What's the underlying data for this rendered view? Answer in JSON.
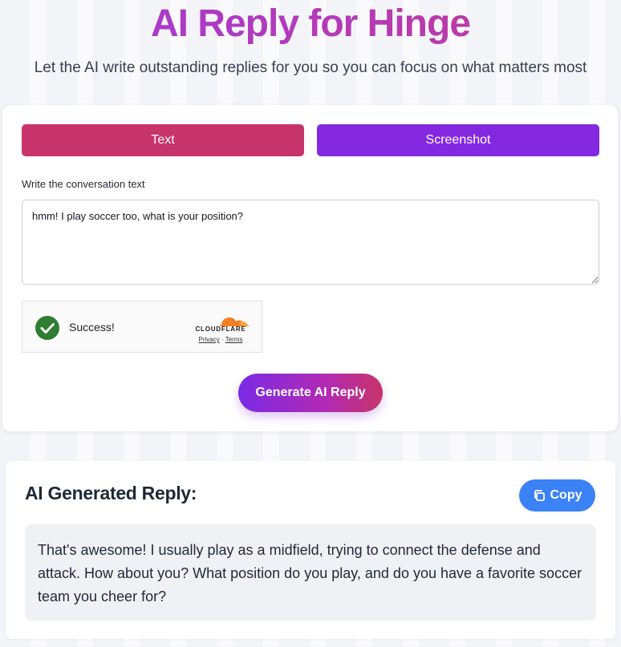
{
  "header": {
    "title": "AI Reply for Hinge",
    "subtitle": "Let the AI write outstanding replies for you so you can focus on what matters most"
  },
  "tabs": [
    {
      "label": "Text",
      "color": "#c7346a"
    },
    {
      "label": "Screenshot",
      "color": "#8428e0"
    }
  ],
  "form": {
    "label": "Write the conversation text",
    "conversation_text": "hmm! I play soccer too, what is your position?"
  },
  "captcha": {
    "status": "Success!",
    "brand": "CLOUDFLARE",
    "privacy": "Privacy",
    "separator": "·",
    "terms": "Terms",
    "icon": "check-circle-icon"
  },
  "generate_button": {
    "label": "Generate AI Reply"
  },
  "result": {
    "title": "AI Generated Reply:",
    "copy_label": "Copy",
    "copy_icon": "copy-icon",
    "reply_text": "That's awesome! I usually play as a midfield, trying to connect the defense and attack. How about you? What position do you play, and do you have a favorite soccer team you cheer for?"
  },
  "colors": {
    "accent_pink": "#c7346a",
    "accent_purple": "#8428e0",
    "copy_blue": "#3b82f6",
    "success_green": "#2e7d32"
  }
}
